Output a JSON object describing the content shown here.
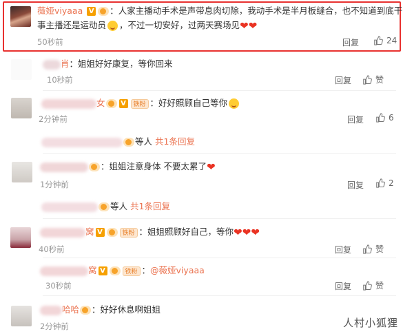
{
  "comments": [
    {
      "username": "薇娅viyaaa",
      "text_line1": "：人家主播动手术是声带息肉切除，我动手术是半月板缝合，也不知道到底干的",
      "text_line2": "事主播还是运动员",
      "text_line2b": "，不过一切安好，过两天赛场见",
      "time": "50秒前",
      "reply_label": "回复",
      "like_count": "24"
    },
    {
      "username_tail": "肖",
      "text": "：姐姐好好康复，等你回来",
      "time": "10秒前",
      "reply_label": "回复",
      "like_count": "赞"
    },
    {
      "username_tail": "女",
      "fan_label": "铁粉",
      "text": "：好好照顾自己等你",
      "time": "2分钟前",
      "reply_label": "回复",
      "like_count": "6"
    },
    {
      "text": "：姐姐注意身体 不要太累了",
      "time": "1分钟前",
      "reply_label": "回复",
      "like_count": "2"
    },
    {
      "username_tail": "窝",
      "fan_label": "铁粉",
      "text": "：姐姐照顾好自己，等你",
      "time": "40秒前",
      "reply_label": "回复",
      "like_count": "赞"
    },
    {
      "username_tail": "窝",
      "fan_label": "铁粉",
      "text_prefix": "：",
      "mention": "@薇娅viyaaa",
      "time": "30秒前",
      "reply_label": "回复",
      "like_count": "赞"
    },
    {
      "username_tail": "哈哈",
      "text": "：好好休息啊姐姐",
      "time": "2分钟前"
    }
  ],
  "reply_summaries": [
    {
      "text": "等人",
      "link": "共1条回复"
    },
    {
      "text": "等人",
      "link": "共1条回复"
    }
  ],
  "watermark": "人村小狐狸"
}
